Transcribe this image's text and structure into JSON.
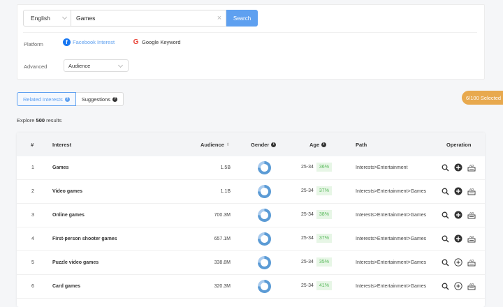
{
  "search": {
    "language": "English",
    "keyword": "Games",
    "button_label": "Search"
  },
  "filters": {
    "platform_label": "Platform",
    "platforms": [
      {
        "label": "Facebook Interest",
        "active": true,
        "color": "#5ea0f0"
      },
      {
        "label": "Google Keyword",
        "active": false,
        "color": "#333333"
      }
    ],
    "advanced_label": "Advanced",
    "advanced_value": "Audience"
  },
  "tabs": [
    {
      "label": "Related Interests",
      "active": true
    },
    {
      "label": "Suggestions",
      "active": false
    }
  ],
  "selected_badge": "6/100 Selected",
  "explore": {
    "prefix": "Explore",
    "count": "500",
    "suffix": "results"
  },
  "table": {
    "headers": {
      "num": "#",
      "interest": "Interest",
      "audience": "Audience",
      "gender": "Gender",
      "age": "Age",
      "path": "Path",
      "operation": "Operation"
    },
    "rows": [
      {
        "num": "1",
        "interest": "Games",
        "audience": "1.5B",
        "age": "25-34",
        "pct": "36%",
        "path": "Interests>Entertainment",
        "added": true,
        "gender_share": 0.75
      },
      {
        "num": "2",
        "interest": "Video games",
        "audience": "1.1B",
        "age": "25-34",
        "pct": "37%",
        "path": "Interests>Entertainment>Games",
        "added": true,
        "gender_share": 0.75
      },
      {
        "num": "3",
        "interest": "Online games",
        "audience": "700.3M",
        "age": "25-34",
        "pct": "38%",
        "path": "Interests>Entertainment>Games",
        "added": true,
        "gender_share": 0.75
      },
      {
        "num": "4",
        "interest": "First-person shooter games",
        "audience": "657.1M",
        "age": "25-34",
        "pct": "37%",
        "path": "Interests>Entertainment>Games",
        "added": true,
        "gender_share": 0.75
      },
      {
        "num": "5",
        "interest": "Puzzle video games",
        "audience": "338.8M",
        "age": "25-34",
        "pct": "35%",
        "path": "Interests>Entertainment>Games",
        "added": false,
        "gender_share": 0.75
      },
      {
        "num": "6",
        "interest": "Card games",
        "audience": "320.3M",
        "age": "25-34",
        "pct": "41%",
        "path": "Interests>Entertainment>Games",
        "added": false,
        "gender_share": 0.75
      }
    ]
  },
  "colors": {
    "accent": "#5ea0f0",
    "badge": "#e8a94e",
    "pct_bg": "#e7f6e6",
    "pct_text": "#57b85a",
    "donut_main": "#5b9bd5",
    "donut_minor": "#a9cbee"
  }
}
